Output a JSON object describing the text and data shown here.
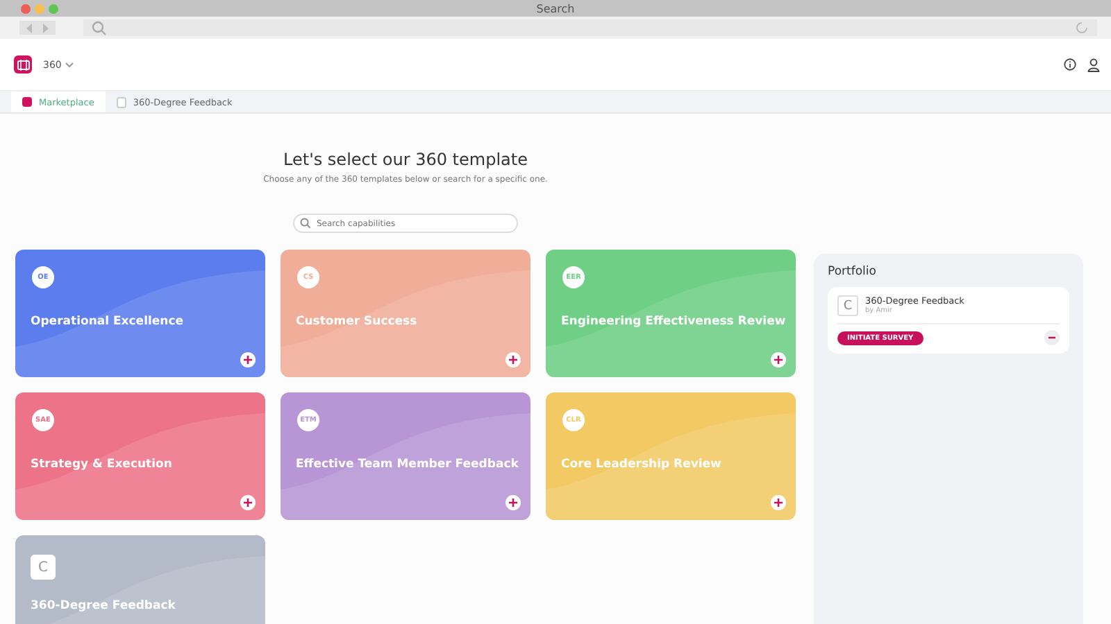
{
  "window": {
    "title": "Search"
  },
  "app": {
    "name": "360"
  },
  "tabs": [
    {
      "label": "Marketplace",
      "selected": true,
      "kind": "home"
    },
    {
      "label": "360-Degree Feedback",
      "selected": false,
      "kind": "template"
    }
  ],
  "heading": "Let's select our 360 template",
  "subheading": "Choose any of the 360 templates below or search for a specific one.",
  "search": {
    "placeholder": "Search capabilities"
  },
  "templates": [
    {
      "badge": "OE",
      "title": "Operational Excellence",
      "color": "#5b7ded",
      "kind": "builtin"
    },
    {
      "badge": "CS",
      "title": "Customer Success",
      "color": "#f0ae98",
      "kind": "builtin"
    },
    {
      "badge": "EER",
      "title": "Engineering Effectiveness Review",
      "color": "#6fcf85",
      "kind": "builtin"
    },
    {
      "badge": "SAE",
      "title": "Strategy & Execution",
      "color": "#ec7388",
      "kind": "builtin"
    },
    {
      "badge": "ETM",
      "title": "Effective Team Member Feedback",
      "color": "#b896d6",
      "kind": "builtin"
    },
    {
      "badge": "CLR",
      "title": "Core Leadership Review",
      "color": "#f2c963",
      "kind": "builtin"
    },
    {
      "badge": "C",
      "title": "360-Degree Feedback",
      "color": "#b3bac8",
      "kind": "custom"
    }
  ],
  "portfolio": {
    "title": "Portfolio",
    "items": [
      {
        "icon": "C",
        "title": "360-Degree Feedback",
        "author": "by Amir",
        "action": "INITIATE SURVEY"
      }
    ]
  }
}
